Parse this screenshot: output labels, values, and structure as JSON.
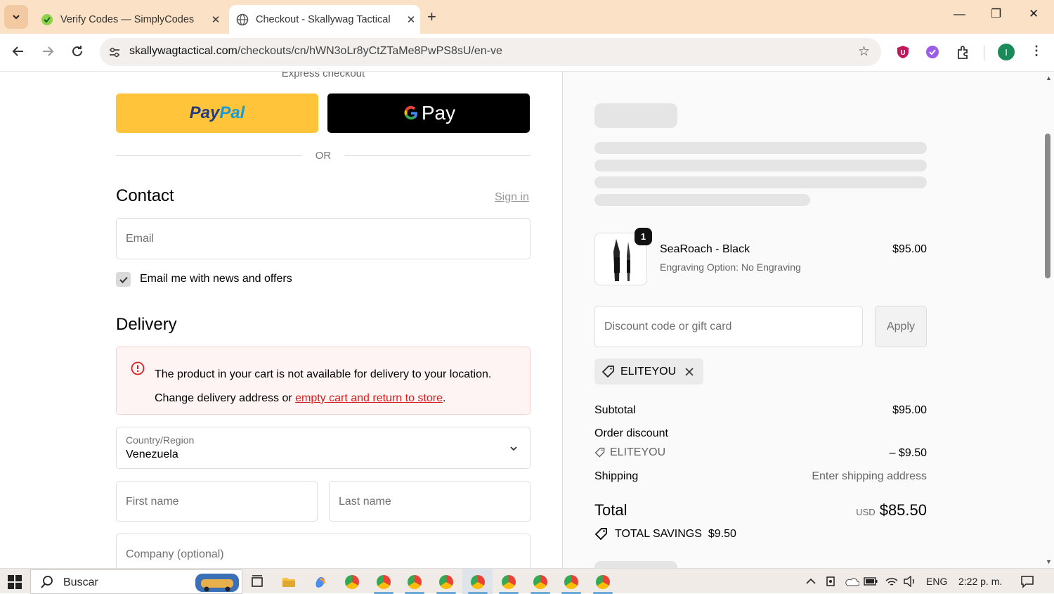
{
  "browser": {
    "tabs": [
      {
        "title": "Verify Codes — SimplyCodes",
        "active": false
      },
      {
        "title": "Checkout - Skallywag Tactical",
        "active": true
      }
    ],
    "url_host": "skallywagtactical.com",
    "url_path": "/checkouts/cn/hWN3oLr8yCtZTaMe8PwPS8sU/en-ve",
    "profile_initial": "I"
  },
  "checkout": {
    "express_label": "Express checkout",
    "paypal_label": "PayPal",
    "gpay_label": "Pay",
    "or_label": "OR",
    "contact_heading": "Contact",
    "sign_in": "Sign in",
    "email_placeholder": "Email",
    "news_checkbox_label": "Email me with news and offers",
    "news_checked": true,
    "delivery_heading": "Delivery",
    "alert_line1": "The product in your cart is not available for delivery to your location.",
    "alert_line2_pre": "Change delivery address or ",
    "alert_link": "empty cart and return to store",
    "alert_line2_post": ".",
    "country_label": "Country/Region",
    "country_value": "Venezuela",
    "first_name_placeholder": "First name",
    "last_name_placeholder": "Last name",
    "company_placeholder": "Company (optional)"
  },
  "summary": {
    "item": {
      "quantity": "1",
      "name": "SeaRoach - Black",
      "option": "Engraving Option: No Engraving",
      "price": "$95.00"
    },
    "discount_placeholder": "Discount code or gift card",
    "apply_label": "Apply",
    "applied_code": "ELITEYOU",
    "subtotal_label": "Subtotal",
    "subtotal_value": "$95.00",
    "order_discount_label": "Order discount",
    "discount_code": "ELITEYOU",
    "discount_value": "– $9.50",
    "shipping_label": "Shipping",
    "shipping_value": "Enter shipping address",
    "total_label": "Total",
    "currency": "USD",
    "total_value": "$85.50",
    "savings_label": "TOTAL SAVINGS",
    "savings_value": "$9.50"
  },
  "taskbar": {
    "search_label": "Buscar",
    "language": "ENG",
    "time": "2:22 p. m."
  }
}
